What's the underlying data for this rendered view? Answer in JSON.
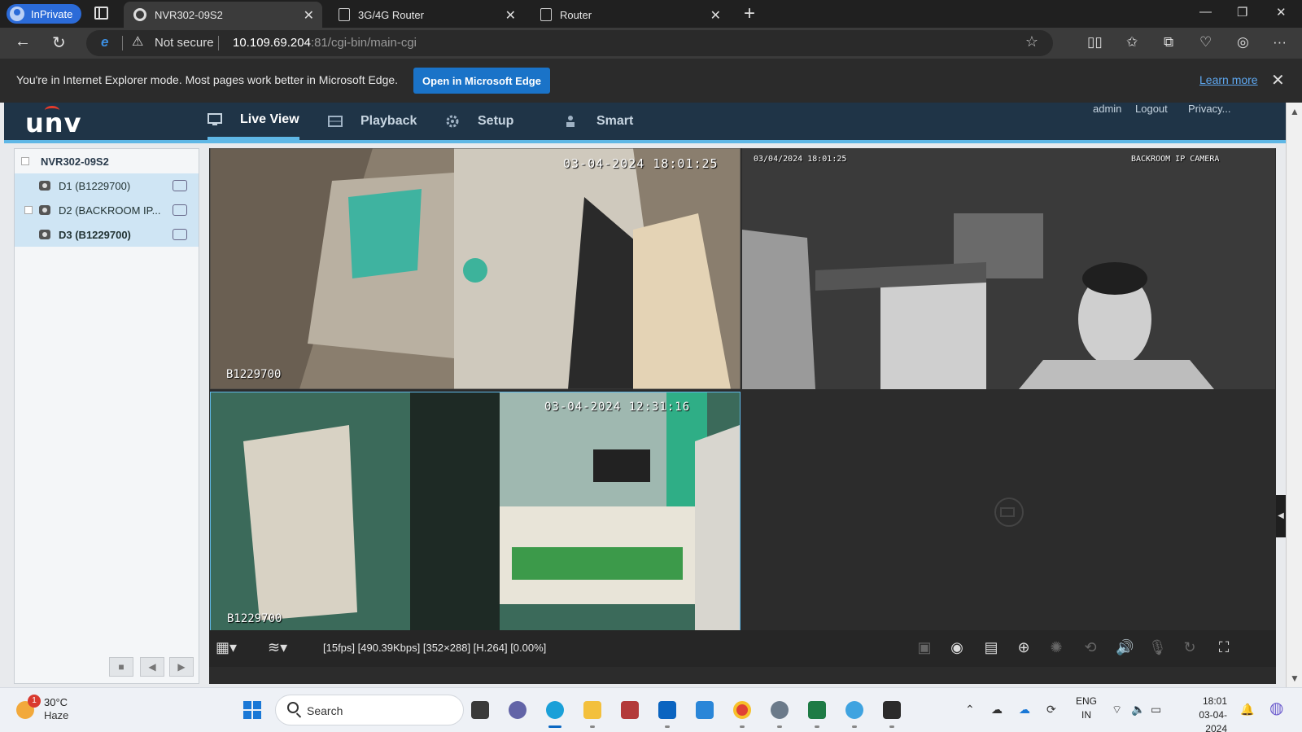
{
  "browser": {
    "inprivate_label": "InPrivate",
    "tabs": [
      {
        "title": "NVR302-09S2",
        "active": true
      },
      {
        "title": "3G/4G Router",
        "active": false
      },
      {
        "title": "Router",
        "active": false
      }
    ],
    "address": {
      "security": "Not secure",
      "url_host": "10.109.69.204",
      "url_path": ":81/cgi-bin/main-cgi"
    },
    "infobar": {
      "message": "You're in Internet Explorer mode. Most pages work better in Microsoft Edge.",
      "open_button": "Open in Microsoft Edge",
      "learn_more": "Learn more"
    }
  },
  "app": {
    "logo": "unv",
    "nav": [
      {
        "label": "Live View",
        "active": true
      },
      {
        "label": "Playback",
        "active": false
      },
      {
        "label": "Setup",
        "active": false
      },
      {
        "label": "Smart",
        "active": false
      }
    ],
    "top_links": [
      "admin",
      "Logout",
      "Privacy..."
    ],
    "device_tree": {
      "root": "NVR302-09S2",
      "channels": [
        {
          "label": "D1 (B1229700)",
          "bold": false
        },
        {
          "label": "D2 (BACKROOM IP...",
          "bold": false
        },
        {
          "label": "D3 (B1229700)",
          "bold": true
        }
      ]
    },
    "tiles": [
      {
        "time": "03-04-2024 18:01:25",
        "name": "B1229700"
      },
      {
        "time": "03/04/2024 18:01:25",
        "name": "BACKROOM IP CAMERA"
      },
      {
        "time": "03-04-2024 12:31:16",
        "name": "B1229700"
      }
    ],
    "stream_status": "[15fps] [490.39Kbps] [352×288] [H.264] [0.00%]"
  },
  "taskbar": {
    "weather_temp": "30°C",
    "weather_desc": "Haze",
    "weather_badge": "1",
    "search_label": "Search",
    "lang_top": "ENG",
    "lang_bottom": "IN",
    "time": "18:01",
    "date": "03-04-2024"
  },
  "colors": {
    "app_header": "#1f3447",
    "accent": "#5fb7e6",
    "edge_button": "#1a73c8"
  }
}
